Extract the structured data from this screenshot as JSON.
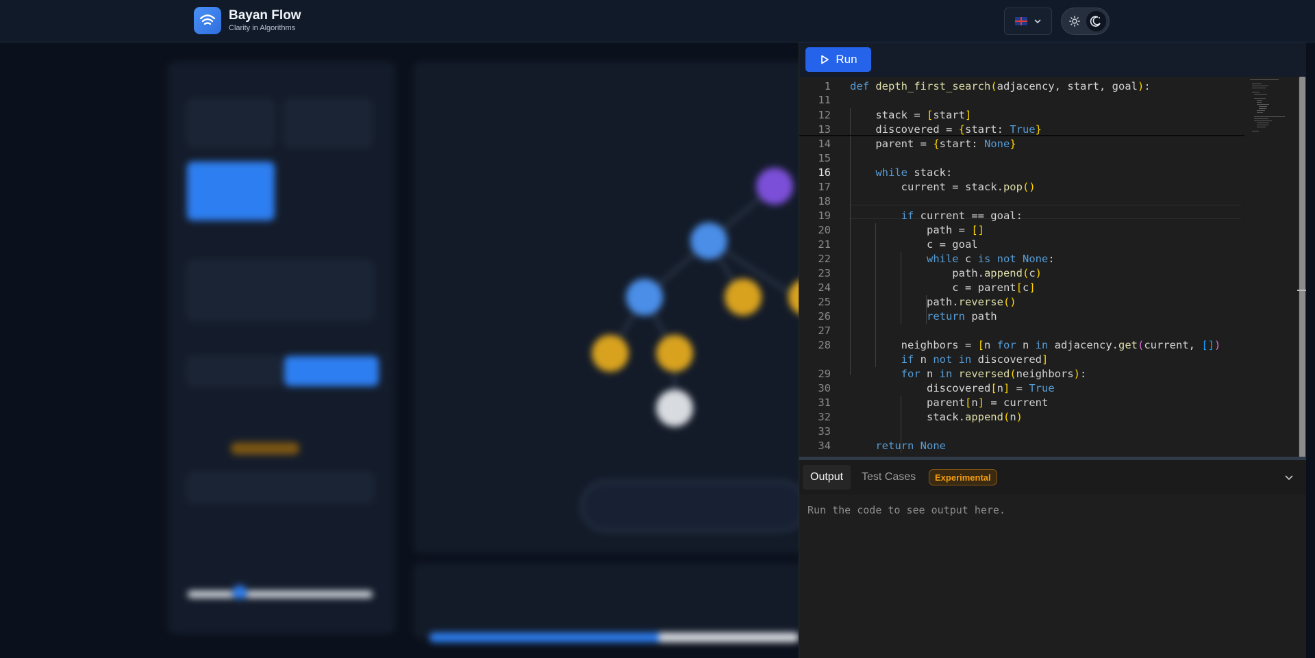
{
  "header": {
    "app_name": "Bayan Flow",
    "tagline": "Clarity in Algorithms",
    "language_flag": "uk-flag-icon",
    "theme_icons": [
      "sun-icon",
      "moon-icon"
    ]
  },
  "colors": {
    "accent": "#2563eb",
    "header_bg": "#111a29",
    "editor_bg": "#1e1e1e",
    "badge": "#f59e0b"
  },
  "editor": {
    "run_label": "Run",
    "current_line": 16,
    "lines": [
      {
        "n": "1",
        "text": "def depth_first_search(adjacency, start, goal):"
      },
      {
        "n": "11",
        "text": ""
      },
      {
        "n": "12",
        "text": "    stack = [start]"
      },
      {
        "n": "13",
        "text": "    discovered = {start: True}"
      },
      {
        "n": "14",
        "text": "    parent = {start: None}"
      },
      {
        "n": "15",
        "text": ""
      },
      {
        "n": "16",
        "text": "    while stack:"
      },
      {
        "n": "17",
        "text": "        current = stack.pop()"
      },
      {
        "n": "18",
        "text": ""
      },
      {
        "n": "19",
        "text": "        if current == goal:"
      },
      {
        "n": "20",
        "text": "            path = []"
      },
      {
        "n": "21",
        "text": "            c = goal"
      },
      {
        "n": "22",
        "text": "            while c is not None:"
      },
      {
        "n": "23",
        "text": "                path.append(c)"
      },
      {
        "n": "24",
        "text": "                c = parent[c]"
      },
      {
        "n": "25",
        "text": "            path.reverse()"
      },
      {
        "n": "26",
        "text": "            return path"
      },
      {
        "n": "27",
        "text": ""
      },
      {
        "n": "28",
        "text": "        neighbors = [n for n in adjacency.get(current, [])"
      },
      {
        "n": "",
        "text": "        if n not in discovered]"
      },
      {
        "n": "29",
        "text": "        for n in reversed(neighbors):"
      },
      {
        "n": "30",
        "text": "            discovered[n] = True"
      },
      {
        "n": "31",
        "text": "            parent[n] = current"
      },
      {
        "n": "32",
        "text": "            stack.append(n)"
      },
      {
        "n": "33",
        "text": ""
      },
      {
        "n": "34",
        "text": "    return None"
      }
    ]
  },
  "output_panel": {
    "tabs": [
      {
        "label": "Output",
        "active": true
      },
      {
        "label": "Test Cases",
        "active": false
      }
    ],
    "badge": "Experimental",
    "placeholder": "Run the code to see output here."
  }
}
